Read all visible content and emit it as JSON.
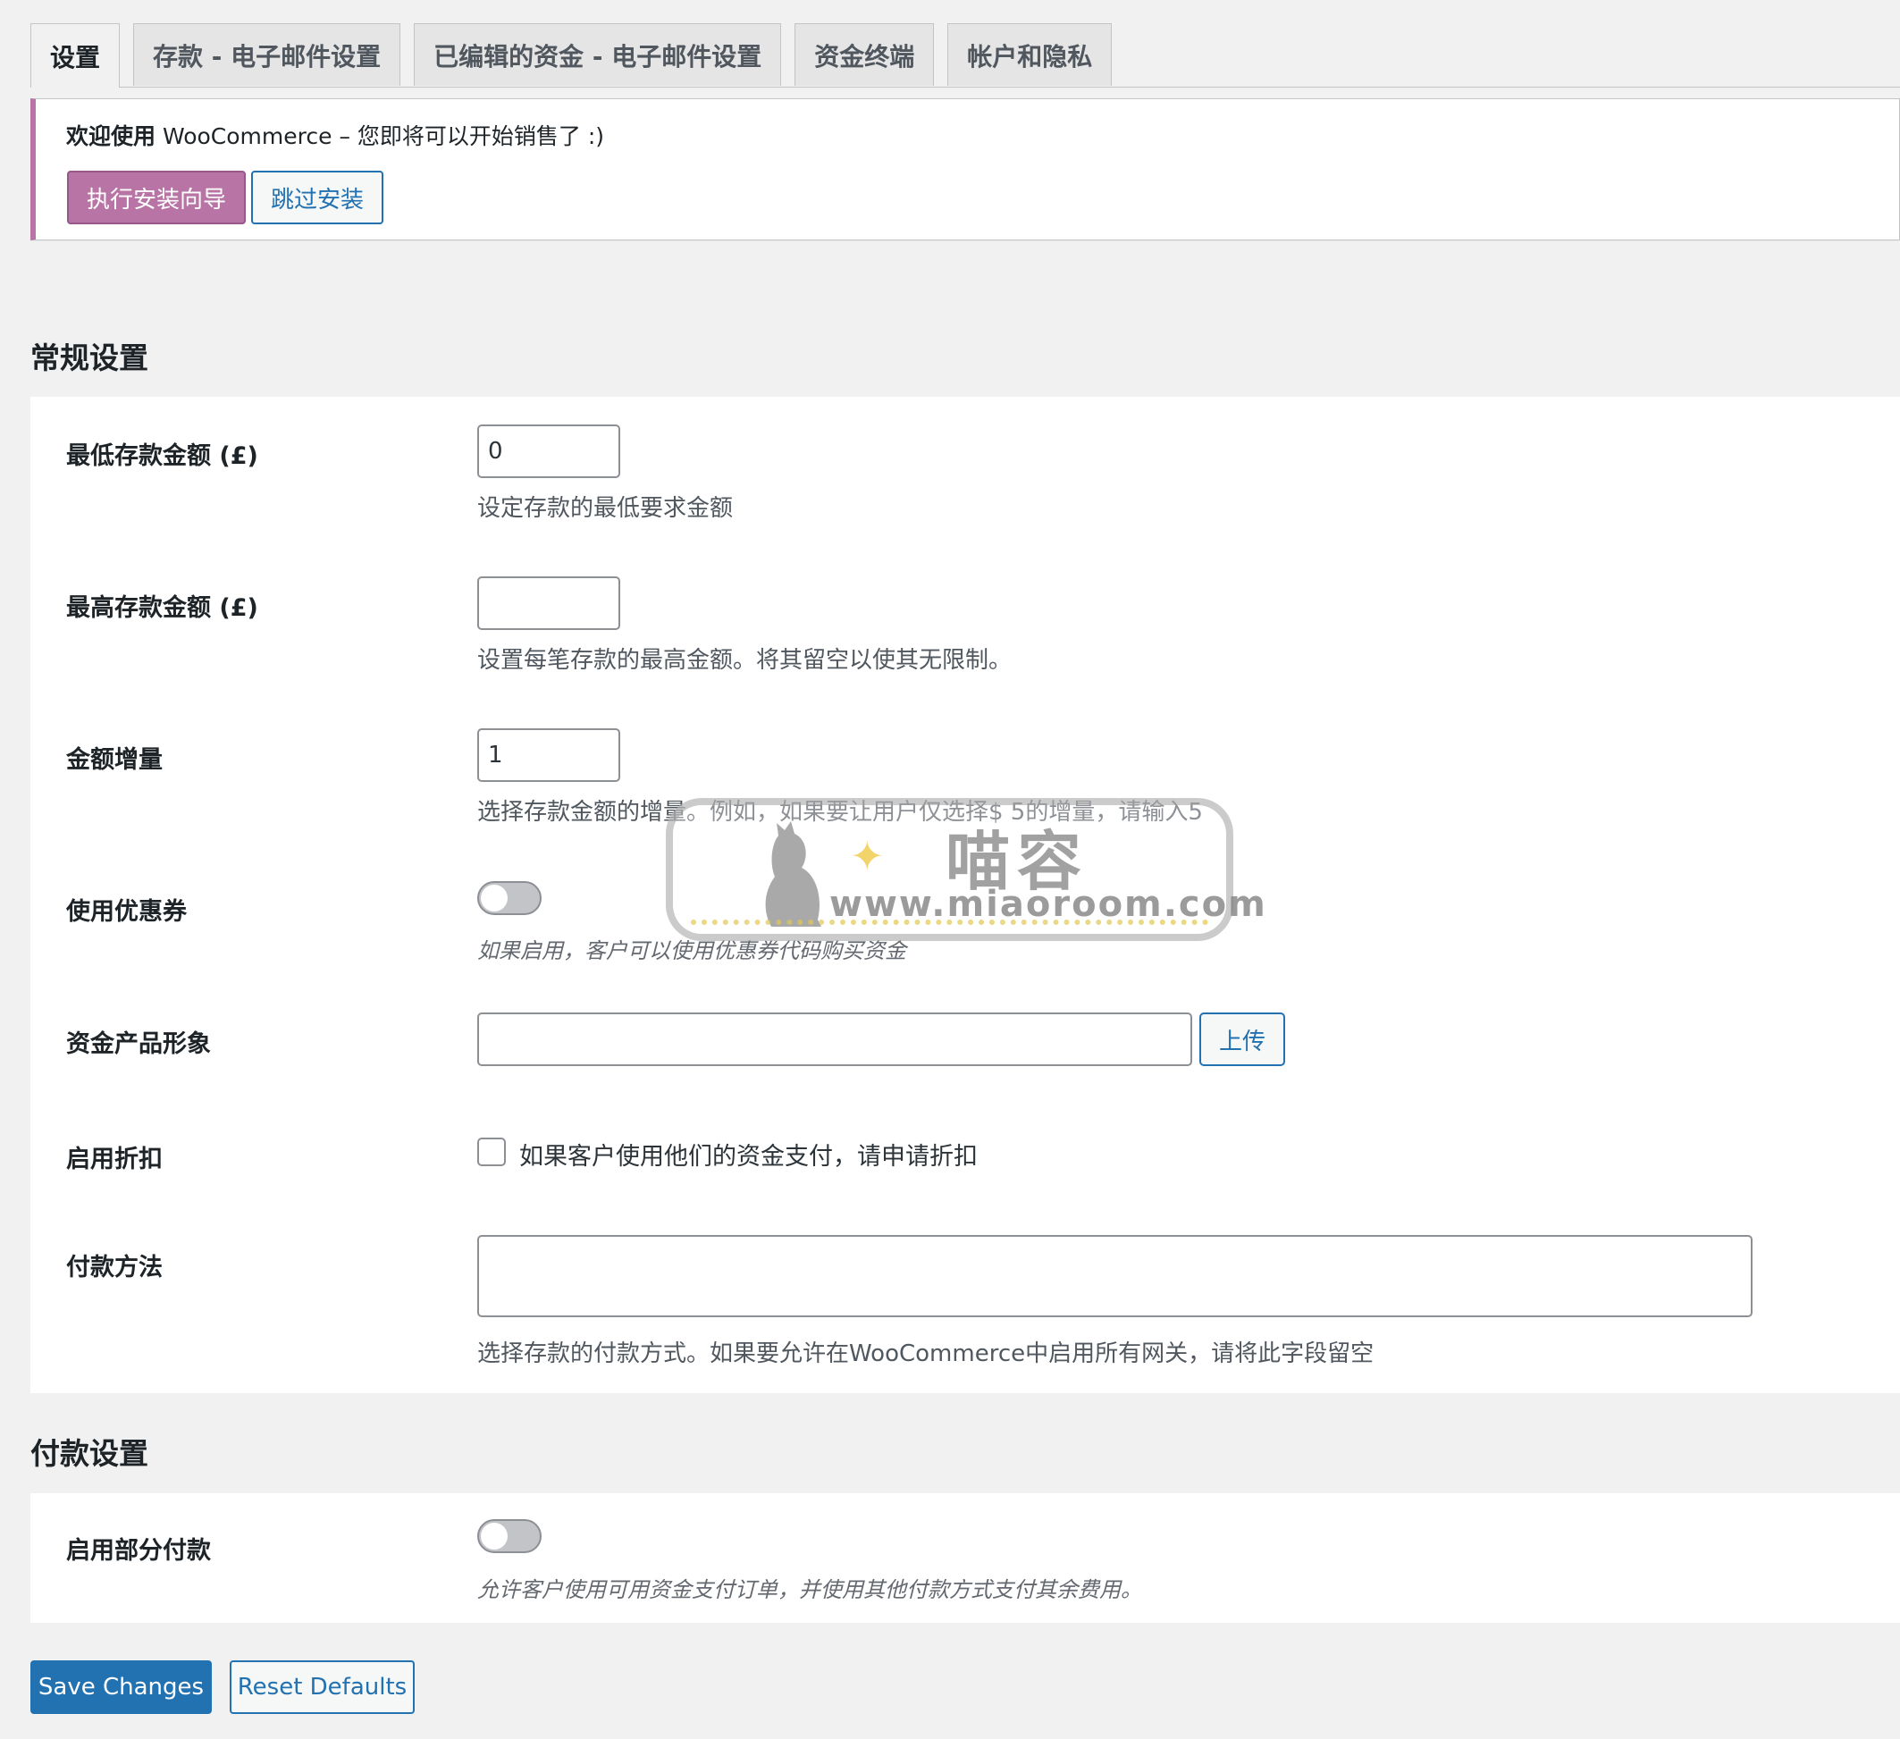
{
  "tabs": [
    {
      "label": "设置",
      "active": true
    },
    {
      "label": "存款 - 电子邮件设置",
      "active": false
    },
    {
      "label": "已编辑的资金 - 电子邮件设置",
      "active": false
    },
    {
      "label": "资金终端",
      "active": false
    },
    {
      "label": "帐户和隐私",
      "active": false
    }
  ],
  "notice": {
    "bold_text": "欢迎使用",
    "text": " WooCommerce – 您即将可以开始销售了 :)",
    "wizard_button": "执行安装向导",
    "skip_button": "跳过安装",
    "accent_color": "#b974a6"
  },
  "general": {
    "title": "常规设置",
    "min_deposit": {
      "label": "最低存款金额 (£)",
      "value": "0",
      "description": "设定存款的最低要求金额"
    },
    "max_deposit": {
      "label": "最高存款金额 (£)",
      "value": "",
      "description": "设置每笔存款的最高金额。将其留空以使其无限制。"
    },
    "increment": {
      "label": "金额增量",
      "value": "1",
      "description": "选择存款金额的增量。例如，如果要让用户仅选择$ 5的增量，请输入5"
    },
    "coupons": {
      "label": "使用优惠券",
      "enabled": false,
      "description": "如果启用，客户可以使用优惠券代码购买资金"
    },
    "product_image": {
      "label": "资金产品形象",
      "value": "",
      "upload_button": "上传"
    },
    "discount": {
      "label": "启用折扣",
      "checked": false,
      "checkbox_label": "如果客户使用他们的资金支付，请申请折扣"
    },
    "payment_methods": {
      "label": "付款方法",
      "value": "",
      "description": "选择存款的付款方式。如果要允许在WooCommerce中启用所有网关，请将此字段留空"
    }
  },
  "payment": {
    "title": "付款设置",
    "partial": {
      "label": "启用部分付款",
      "enabled": false,
      "description": "允许客户使用可用资金支付订单，并使用其他付款方式支付其余费用。"
    }
  },
  "watermark": {
    "cn": "喵容",
    "url": "www.miaoroom.com"
  },
  "footer": {
    "save_button": "Save Changes",
    "reset_button": "Reset Defaults",
    "primary_color": "#2271b1"
  }
}
